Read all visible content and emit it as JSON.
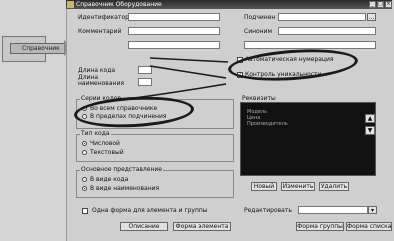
{
  "window": {
    "title": "Справочник Оборудование",
    "controls": [
      "_",
      "□",
      "×"
    ]
  },
  "callout": {
    "label": "Справочник"
  },
  "fields": {
    "identifier_label": "Идентификатор",
    "synonym_label": "Синоним",
    "comment_label": "Комментарий",
    "subordinate_label": "Подчинен",
    "subordinate_value": "",
    "owner_label": "Синоним",
    "code_length_label": "Длина кода",
    "code_length_value": "",
    "name_length_label": "Длина наименования",
    "name_length_value": ""
  },
  "options": {
    "auto_numbering": "Автоматическая нумерация",
    "uniqueness_control": "Контроль уникальности"
  },
  "series": {
    "title": "Серии кодов",
    "options": [
      "Во всем справочнике",
      "В пределах подчинения"
    ],
    "selected": 0
  },
  "code_type": {
    "title": "Тип кода",
    "options": [
      "Числовой",
      "Текстовый"
    ],
    "selected": 0
  },
  "main_view": {
    "title": "Основное представление",
    "options": [
      "В виде кода",
      "В виде наименования"
    ],
    "selected": 1
  },
  "attributes": {
    "title": "Реквизиты",
    "items": [
      "Модель",
      "Цена",
      "Производитель"
    ],
    "buttons": [
      "Новый",
      "Изменить",
      "Удалить"
    ]
  },
  "one_form": {
    "label": "Одна форма для элемента и группы"
  },
  "edit": {
    "label": "Редактировать",
    "value": ""
  },
  "bottom_buttons": [
    "Описание",
    "Форма элемента",
    "Форма группы",
    "Форма списка"
  ],
  "colors": {
    "titlebar": "#2a2a2a",
    "highlight_ellipse": "#1a1a1a"
  }
}
